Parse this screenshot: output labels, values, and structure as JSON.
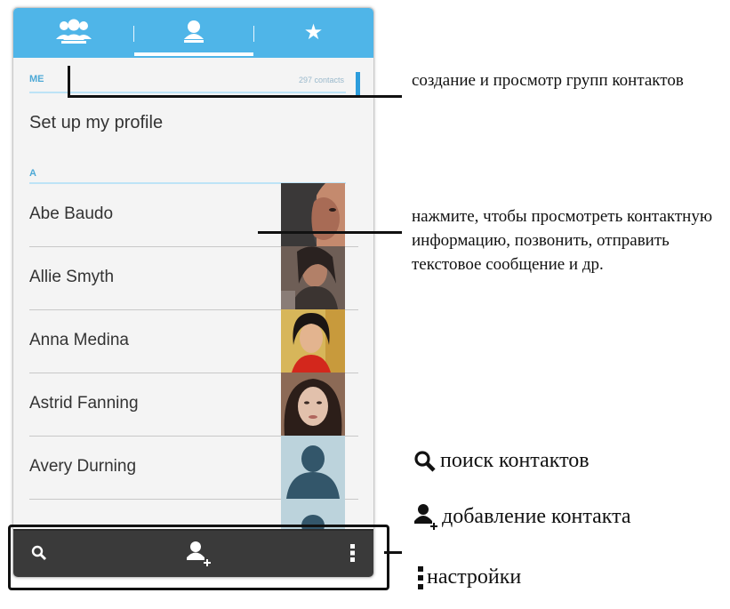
{
  "tabs": [
    {
      "name": "groups",
      "icon": "groups-icon"
    },
    {
      "name": "contacts",
      "icon": "person-icon",
      "selected": true
    },
    {
      "name": "favorites",
      "icon": "star-icon"
    }
  ],
  "list": {
    "me_header": "ME",
    "me_count": "297 contacts",
    "profile": "Set up my profile",
    "section": "A",
    "contacts": [
      {
        "name": "Abe Baudo"
      },
      {
        "name": "Allie Smyth"
      },
      {
        "name": "Anna Medina"
      },
      {
        "name": "Astrid Fanning"
      },
      {
        "name": "Avery Durning"
      }
    ]
  },
  "bottom_bar": [
    "search-icon",
    "add-contact-icon",
    "overflow-menu-icon"
  ],
  "annotations": {
    "groups": "создание и просмотр групп контактов",
    "contact": "нажмите, чтобы просмотреть контактную информацию, позвонить, отправить текстовое сообщение и др.",
    "search": "поиск контактов",
    "add": "добавление контакта",
    "settings": "настройки"
  },
  "colors": {
    "accent": "#4fb5e8",
    "bottom_bar": "#3a3a3a",
    "divider": "#bde3f6"
  }
}
